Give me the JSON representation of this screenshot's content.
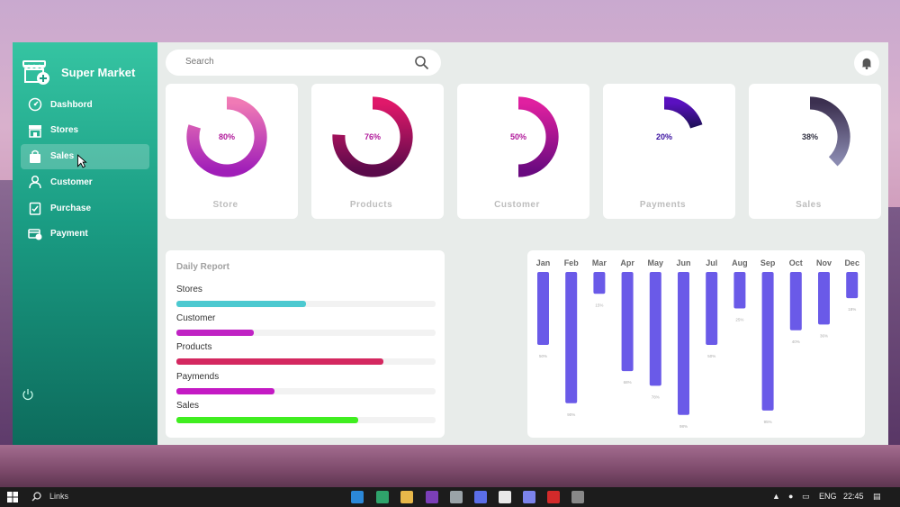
{
  "brand": {
    "name": "Super Market"
  },
  "nav": [
    {
      "label": "Dashbord",
      "icon": "dashboard-icon"
    },
    {
      "label": "Stores",
      "icon": "store-icon"
    },
    {
      "label": "Sales",
      "icon": "bag-icon",
      "active": true
    },
    {
      "label": "Customer",
      "icon": "user-icon"
    },
    {
      "label": "Purchase",
      "icon": "clipboard-icon"
    },
    {
      "label": "Payment",
      "icon": "payment-icon"
    }
  ],
  "search": {
    "placeholder": "Search"
  },
  "cards": [
    {
      "label": "Store",
      "percent": "80%",
      "value": 80,
      "colors": [
        "#f07ab5",
        "#a01eb8"
      ],
      "text_color": "#b0189a"
    },
    {
      "label": "Products",
      "percent": "76%",
      "value": 76,
      "colors": [
        "#e0186a",
        "#5a0a4a"
      ],
      "text_color": "#b0189a"
    },
    {
      "label": "Customer",
      "percent": "50%",
      "value": 50,
      "colors": [
        "#e020a0",
        "#6a0a80"
      ],
      "text_color": "#b0189a"
    },
    {
      "label": "Payments",
      "percent": "20%",
      "value": 20,
      "colors": [
        "#5a10c0",
        "#20105a"
      ],
      "text_color": "#3a10a0"
    },
    {
      "label": "Sales",
      "percent": "38%",
      "value": 38,
      "colors": [
        "#3c3050",
        "#8a8ab0"
      ],
      "text_color": "#303040"
    }
  ],
  "daily_report": {
    "title": "Daily Report",
    "rows": [
      {
        "label": "Stores",
        "value": 50,
        "color": "#4cc9d0"
      },
      {
        "label": "Customer",
        "value": 30,
        "color": "#c023c4"
      },
      {
        "label": "Products",
        "value": 80,
        "color": "#d42860"
      },
      {
        "label": "Paymends",
        "value": 38,
        "color": "#c41ac4"
      },
      {
        "label": "Sales",
        "value": 70,
        "color": "#40ee20"
      }
    ]
  },
  "chart_data": {
    "type": "bar",
    "categories": [
      "Jan",
      "Feb",
      "Mar",
      "Apr",
      "May",
      "Jun",
      "Jul",
      "Aug",
      "Sep",
      "Oct",
      "Nov",
      "Dec"
    ],
    "values": [
      50,
      90,
      15,
      68,
      78,
      98,
      50,
      25,
      95,
      40,
      36,
      18
    ],
    "value_labels": [
      "50%",
      "90%",
      "15%",
      "68%",
      "78%",
      "98%",
      "50%",
      "25%",
      "95%",
      "40%",
      "36%",
      "18%"
    ],
    "color": "#6a5ae8",
    "orientation": "downward",
    "ylim": [
      0,
      100
    ]
  },
  "taskbar": {
    "search_text": "Links",
    "language": "ENG",
    "time": "22:45"
  }
}
